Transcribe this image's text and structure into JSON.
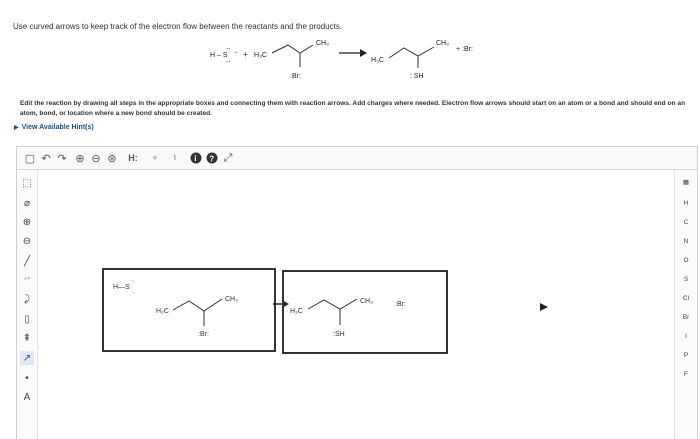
{
  "instruction": "Use curved arrows to keep track of the electron flow between the reactants and the products.",
  "reaction": {
    "hs_minus": "H–S",
    "plus1": "+",
    "ch3_label": "CH3",
    "h3c_label": "H3C",
    "br_label": ":Br:",
    "product_sh": ":SH",
    "product_br": "+ :Br:"
  },
  "edit_text": "Edit the reaction by drawing all steps in the appropriate boxes and connecting them with reaction arrows. Add charges where needed. Electron flow arrows should start on an atom or a bond and should end on an atom, bond, or location where a new bond should be created.",
  "hints_label": "View Available Hint(s)",
  "toolbar": {
    "h_label": "H:"
  },
  "elements": [
    "H",
    "C",
    "N",
    "O",
    "S",
    "Cl",
    "Br",
    "I",
    "P",
    "F"
  ],
  "canvas": {
    "box1": {
      "reagent": "H—S",
      "ch3": "CH3",
      "h3c": "H3C",
      "br": "Br"
    },
    "box2": {
      "ch3": "CH3",
      "h3c": "H3C",
      "sh": "SH",
      "br": "Br"
    }
  }
}
